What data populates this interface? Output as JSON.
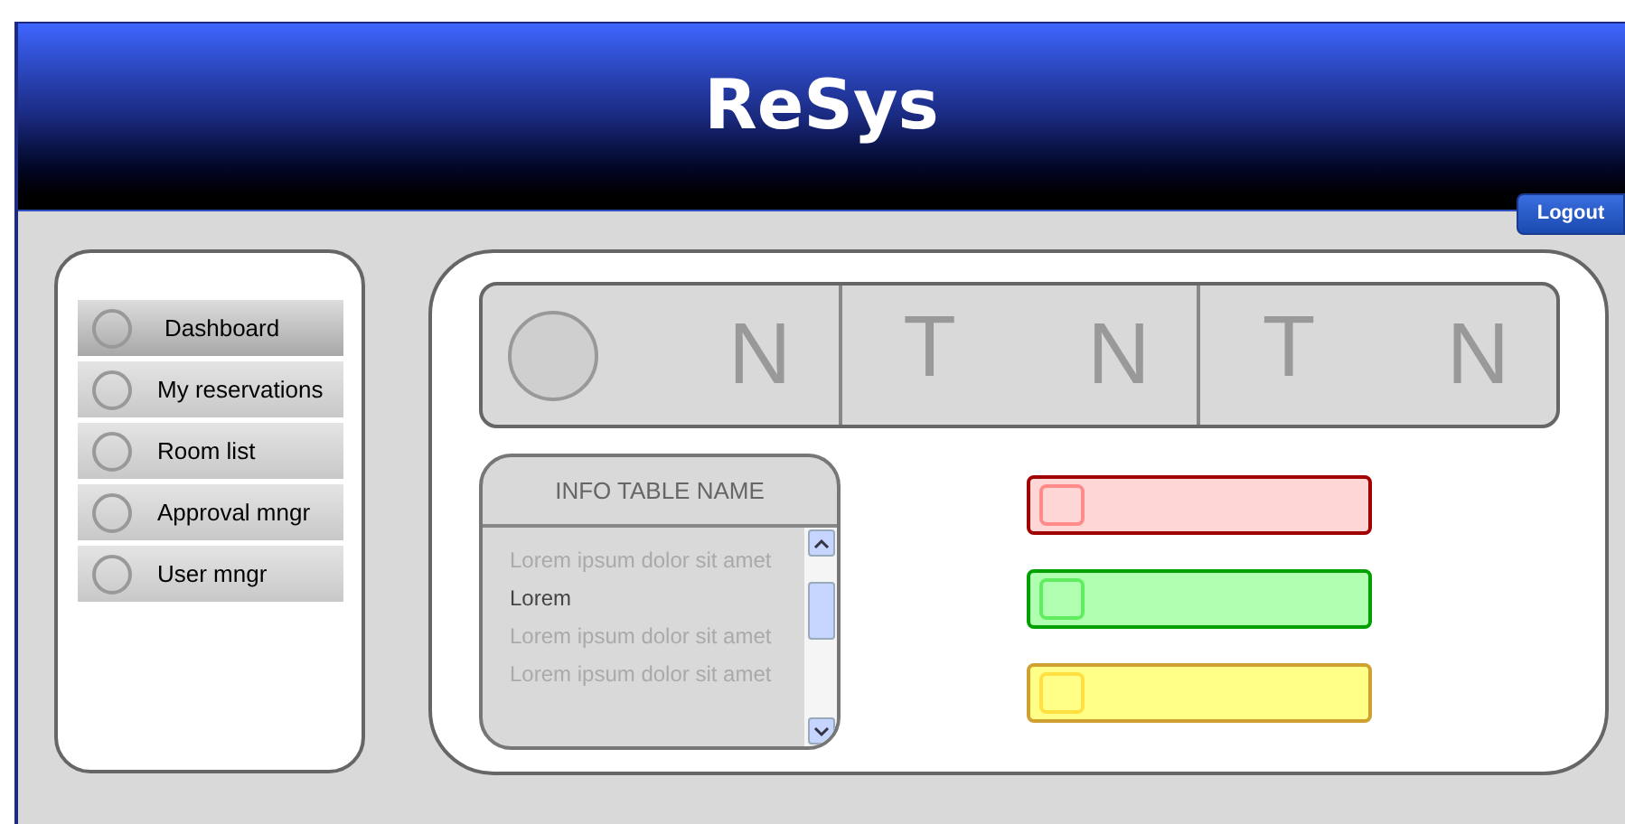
{
  "header": {
    "title": "ReSys",
    "logout": "Logout"
  },
  "sidebar": {
    "items": [
      {
        "label": "Dashboard",
        "selected": true
      },
      {
        "label": "My reservations",
        "selected": false
      },
      {
        "label": "Room list",
        "selected": false
      },
      {
        "label": "Approval mngr",
        "selected": false
      },
      {
        "label": "User mngr",
        "selected": false
      }
    ]
  },
  "stats": [
    {
      "kind": "icon",
      "value": "N"
    },
    {
      "kind": "label",
      "label": "T",
      "value": "N"
    },
    {
      "kind": "label",
      "label": "T",
      "value": "N"
    }
  ],
  "info_table": {
    "title": "INFO TABLE NAME",
    "rows": [
      {
        "text": "Lorem ipsum dolor sit amet",
        "selected": false
      },
      {
        "text": "Lorem",
        "selected": true
      },
      {
        "text": "Lorem ipsum dolor sit amet",
        "selected": false
      },
      {
        "text": "Lorem ipsum dolor sit amet",
        "selected": false
      }
    ]
  },
  "alerts": [
    {
      "kind": "error",
      "color": "#ffd6d6"
    },
    {
      "kind": "success",
      "color": "#b0ffb0"
    },
    {
      "kind": "warning",
      "color": "#ffff88"
    }
  ]
}
